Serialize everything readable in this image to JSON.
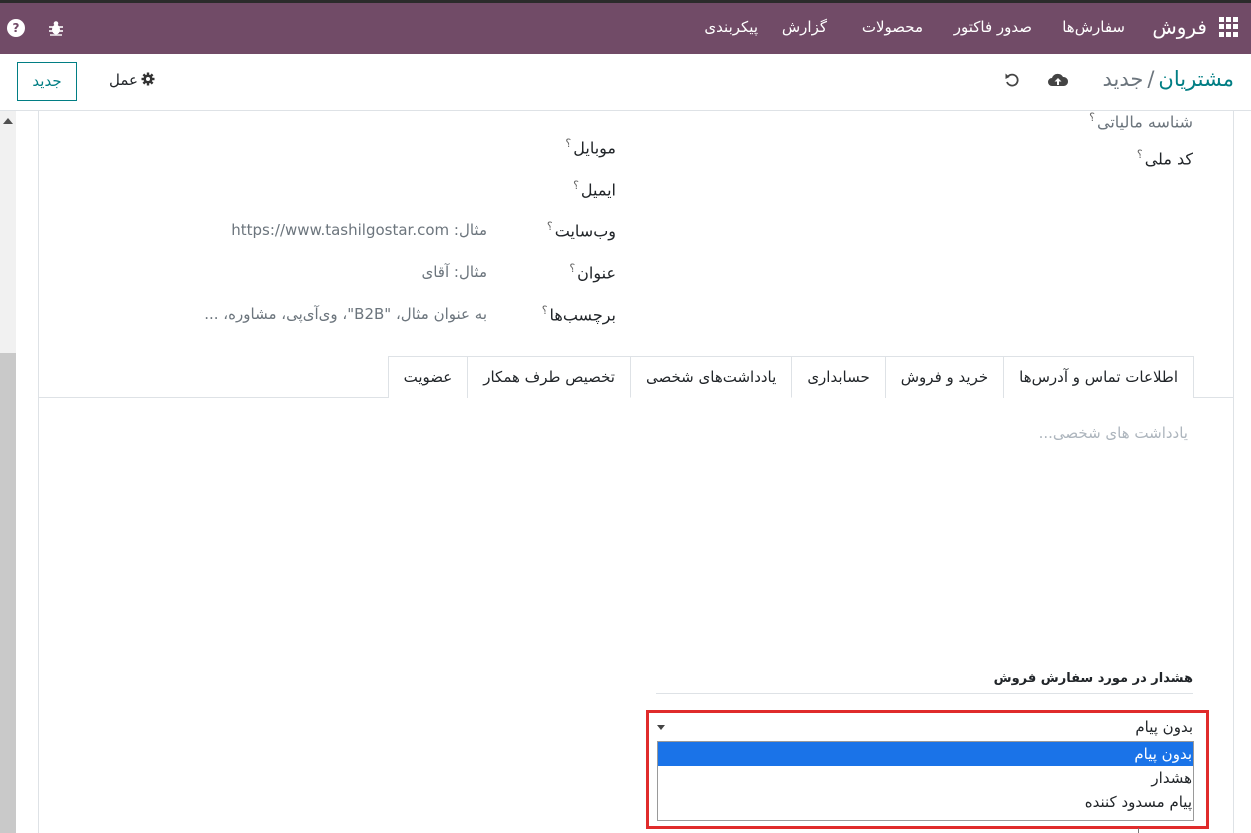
{
  "navbar": {
    "brand": "فروش",
    "menu": [
      "سفارش‌ها",
      "صدور فاکتور",
      "محصولات",
      "گزارش",
      "پیکربندی"
    ],
    "help": "?",
    "color": "#714b67"
  },
  "control": {
    "breadcrumb_parent": "مشتریان",
    "breadcrumb_sep": "/",
    "breadcrumb_current": "جدید",
    "new_button": "جدید",
    "action_button": "عمل"
  },
  "form": {
    "tax_id_label": "شناسه مالیاتی",
    "national_code_label": "کد ملی",
    "mobile_label": "موبایل",
    "email_label": "ایمیل",
    "website_label": "وب‌سایت",
    "website_placeholder": "مثال: https://www.tashilgostar.com",
    "title_label": "عنوان",
    "title_placeholder": "مثال: آقای",
    "tags_label": "برچسب‌ها",
    "tags_placeholder": "به عنوان مثال، \"B2B\"، وی‌آی‌پی، مشاوره، ...",
    "help_mark": "؟"
  },
  "tabs": [
    {
      "label": "اطلاعات تماس و آدرس‌ها",
      "active": false
    },
    {
      "label": "خرید و فروش",
      "active": false
    },
    {
      "label": "حسابداری",
      "active": false
    },
    {
      "label": "یادداشت‌های شخصی",
      "active": true
    },
    {
      "label": "تخصیص طرف همکار",
      "active": false
    },
    {
      "label": "عضویت",
      "active": false
    }
  ],
  "notes": {
    "placeholder": "یادداشت های شخصی..."
  },
  "sale_warning": {
    "title": "هشدار در مورد سفارش فروش",
    "selected": "بدون پیام",
    "options": [
      "بدون پیام",
      "هشدار",
      "پیام مسدود کننده"
    ],
    "highlight_color": "#e02b2b"
  }
}
